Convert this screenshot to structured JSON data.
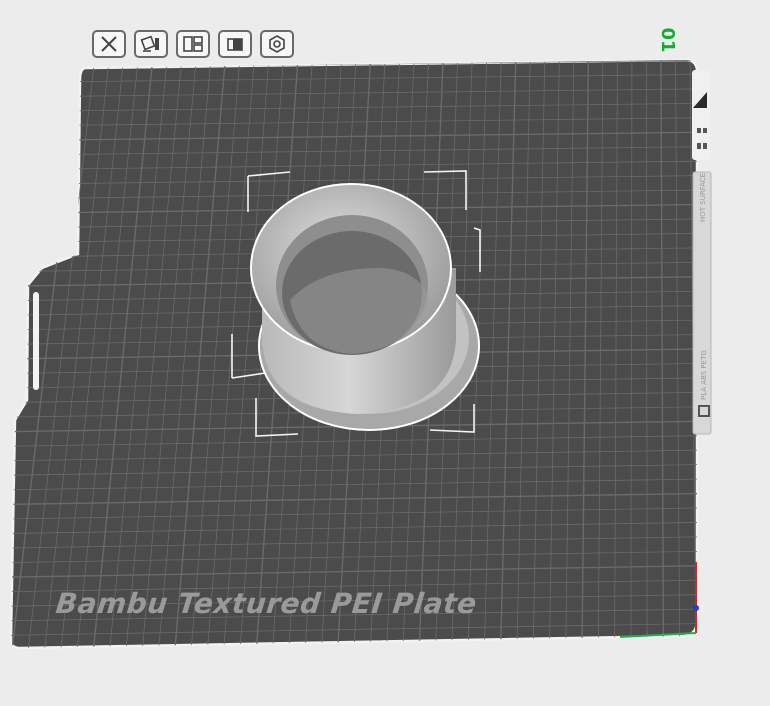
{
  "toolbar": {
    "buttons": [
      {
        "name": "delete-plate",
        "icon": "close-icon"
      },
      {
        "name": "auto-orient",
        "icon": "orient-icon"
      },
      {
        "name": "arrange",
        "icon": "arrange-icon"
      },
      {
        "name": "lock-plate",
        "icon": "lock-icon"
      },
      {
        "name": "plate-settings",
        "icon": "settings-icon"
      }
    ]
  },
  "plate": {
    "index": "01",
    "label": "Bambu Textured PEI Plate",
    "side_text_filaments": "PLA ABS PETG",
    "side_text_top": "HOT SURFACE"
  },
  "colors": {
    "bed": "#4b4b4b",
    "grid": "#6a6a6a",
    "accent": "#10b02e",
    "axis_x": "#22b14c",
    "axis_y": "#e02020",
    "axis_z": "#1f3fd1"
  }
}
